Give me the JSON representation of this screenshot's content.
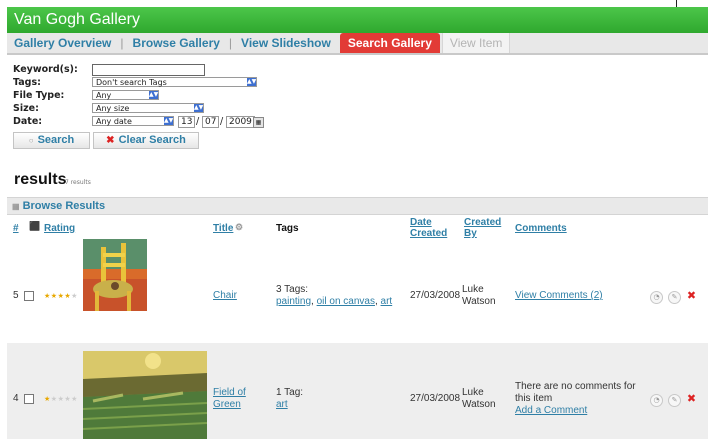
{
  "app": {
    "title": "Van Gogh Gallery"
  },
  "tabs": [
    {
      "label": "Gallery Overview"
    },
    {
      "label": "Browse Gallery"
    },
    {
      "label": "View Slideshow"
    },
    {
      "label": "Search Gallery"
    },
    {
      "label": "View Item"
    }
  ],
  "search": {
    "keywords_label": "Keyword(s):",
    "keywords_value": "",
    "tags_label": "Tags:",
    "tags_value": "Don't search Tags",
    "filetype_label": "File Type:",
    "filetype_value": "Any",
    "size_label": "Size:",
    "size_value": "Any size",
    "date_label": "Date:",
    "date_value": "Any date",
    "date_day": "13",
    "date_month": "07",
    "date_year": "2009",
    "search_button": "Search",
    "clear_button": "Clear Search"
  },
  "results": {
    "title": "results",
    "count": "7 results",
    "panel_title": "Browse Results"
  },
  "table": {
    "headers": {
      "number": "#",
      "rating": "Rating",
      "title": "Title",
      "tags": "Tags",
      "date_created": "Date Created",
      "created_by": "Created By",
      "comments": "Comments"
    },
    "rows": [
      {
        "number": "5",
        "rating": 4,
        "title": "Chair",
        "tags_summary": "3 Tags:",
        "tags": [
          "painting",
          "oil on canvas",
          "art"
        ],
        "date_created": "27/03/2008",
        "created_by": "Luke Watson",
        "comment_link": "View Comments (2)"
      },
      {
        "number": "4",
        "rating": 1,
        "title": "Field of Green",
        "tags_summary": "1 Tag:",
        "tags": [
          "art"
        ],
        "date_created": "27/03/2008",
        "created_by": "Luke Watson",
        "comment_text": "There are no comments for this item",
        "comment_link": "Add a Comment"
      }
    ]
  },
  "colors": {
    "title_bar": "#3cb53c",
    "active_tab": "#e23b36",
    "link": "#2f7fa6",
    "star_on": "#e8a800",
    "star_off": "#cccccc",
    "delete": "#dd2222"
  },
  "icons": {
    "search": "magnifier-icon",
    "clear": "red-x-icon",
    "calendar": "calendar-icon",
    "rating_header": "rating-icon",
    "title_sort": "sort-icon",
    "row_actions": [
      "view-icon",
      "edit-icon",
      "delete-icon"
    ]
  }
}
